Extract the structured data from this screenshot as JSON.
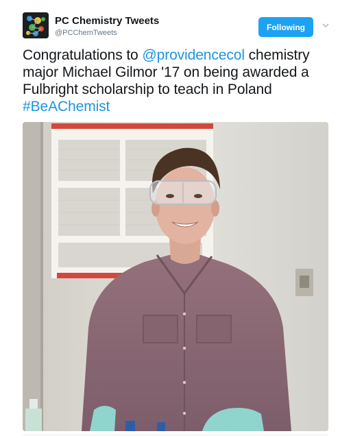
{
  "account": {
    "display_name": "PC Chemistry Tweets",
    "handle": "@PCChemTweets",
    "avatar_icon": "molecule-avatar-icon"
  },
  "follow_button": {
    "label": "Following",
    "color": "#1da1f2"
  },
  "menu": {
    "icon": "chevron-down-icon"
  },
  "tweet": {
    "text_1": "Congratulations to ",
    "mention": "@providencecol",
    "text_2": " chemistry major Michael Gilmor '17 on being awarded a Fulbright scholarship to teach in Poland ",
    "hashtag": "#BeAChemist",
    "link_color": "#1b95e0"
  },
  "photo": {
    "subject": "student-in-safety-goggles-photo",
    "poster_icon": "periodic-table-poster"
  }
}
